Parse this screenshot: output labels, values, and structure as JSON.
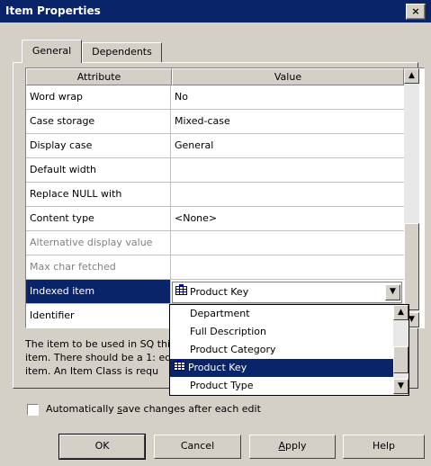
{
  "window": {
    "title": "Item Properties",
    "close_glyph": "×"
  },
  "tabs": [
    {
      "label": "General",
      "active": true
    },
    {
      "label": "Dependents",
      "active": false
    }
  ],
  "grid": {
    "columns": [
      "Attribute",
      "Value"
    ],
    "rows": [
      {
        "attribute": "Word wrap",
        "value": "No",
        "disabled": false
      },
      {
        "attribute": "Case storage",
        "value": "Mixed-case",
        "disabled": false
      },
      {
        "attribute": "Display case",
        "value": "General",
        "disabled": false
      },
      {
        "attribute": "Default width",
        "value": "",
        "disabled": false
      },
      {
        "attribute": "Replace NULL with",
        "value": "",
        "disabled": false
      },
      {
        "attribute": "Content type",
        "value": "<None>",
        "disabled": false
      },
      {
        "attribute": "Alternative display value",
        "value": "",
        "disabled": true
      },
      {
        "attribute": "Max char fetched",
        "value": "",
        "disabled": true
      },
      {
        "attribute": "Indexed item",
        "value": "Product Key",
        "disabled": false,
        "selected": true
      },
      {
        "attribute": "Identifier",
        "value": "",
        "disabled": false
      }
    ]
  },
  "dropdown": {
    "options": [
      "Department",
      "Full Description",
      "Product Category",
      "Product Key",
      "Product Type"
    ],
    "selected": "Product Key"
  },
  "description": "The item to be used in SQ                                                                 this\nitem. There should be a 1:                                                                 ed\nitem. An Item Class is requ",
  "checkbox": {
    "label_pre": "Automatically ",
    "label_accel": "s",
    "label_post": "ave changes after each edit",
    "checked": false
  },
  "buttons": {
    "ok": "OK",
    "cancel": "Cancel",
    "apply_accel": "A",
    "apply_rest": "pply",
    "help": "Help"
  },
  "colors": {
    "selection": "#0a246a",
    "face": "#d4d0c8"
  }
}
